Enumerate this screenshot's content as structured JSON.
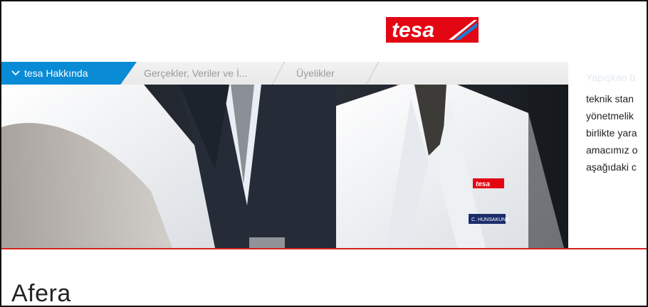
{
  "brand": {
    "logo_text": "tesa",
    "accent": "#e30613"
  },
  "nav": {
    "active_tab": "tesa Hakkında",
    "tabs": [
      "Gerçekler, Veriler ve İ...",
      "Üyelikler"
    ],
    "active_color": "#0a8bd6"
  },
  "side_text": {
    "faded_line": "Yapışkan b",
    "lines": [
      "teknik stan",
      "yönetmelik",
      "birlikte yara",
      "amacımız o",
      "aşağıdaki c"
    ]
  },
  "badges": {
    "coat_logo": "tesa",
    "name_tag": "C. HUNSAKUNA"
  },
  "section": {
    "heading": "Afera"
  }
}
